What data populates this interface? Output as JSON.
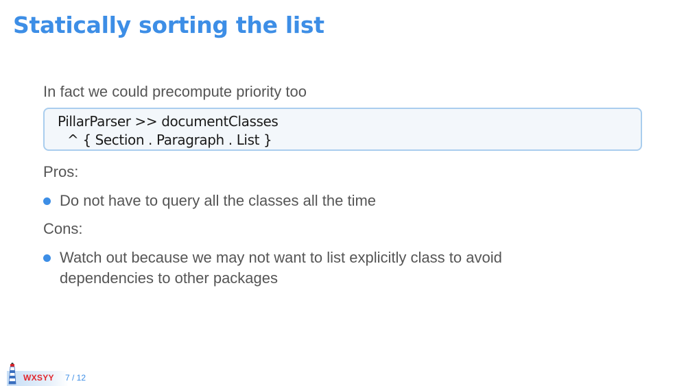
{
  "slide": {
    "title": "Statically sorting the list",
    "intro": "In fact we could precompute priority too",
    "code": {
      "line1": "PillarParser >> documentClasses",
      "line2": "^ { Section . Paragraph . List }"
    },
    "pros_label": "Pros:",
    "pros": [
      "Do not have to query all the classes all the time"
    ],
    "cons_label": "Cons:",
    "cons": [
      "Watch out because we may not want to list explicitly class to avoid dependencies to other packages"
    ]
  },
  "footer": {
    "brand": "WXSYY",
    "page": "7 / 12",
    "logo_icon": "lighthouse-icon"
  },
  "colors": {
    "accent": "#3d8ee6",
    "brand_red": "#e2262c",
    "body_text": "#555555",
    "code_border": "#a9cdee",
    "code_background": "#f3f7fb"
  }
}
